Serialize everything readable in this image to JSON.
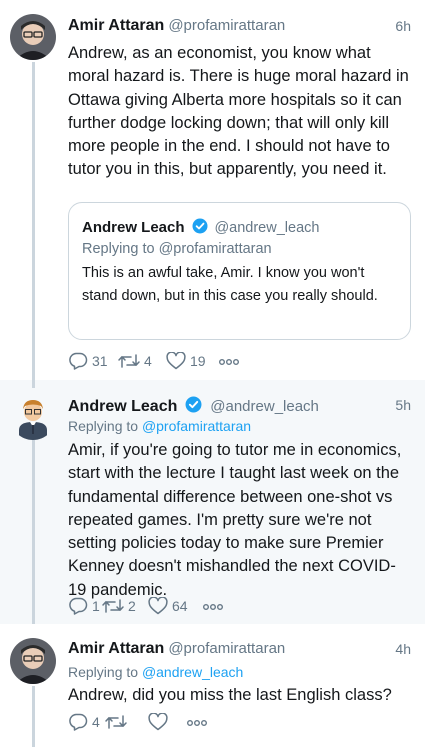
{
  "tweets": [
    {
      "name": "Amir Attaran",
      "handle": "@profamirattaran",
      "time": "6h",
      "text": "Andrew, as an economist, you know what moral hazard is.  There is huge moral hazard in Ottawa giving Alberta more hospitals so it can further dodge locking down; that will only kill more people in the end.  I should not have to tutor you in this, but apparently, you need it.",
      "quote": {
        "name": "Andrew Leach",
        "handle": "@andrew_leach",
        "replying_label": "Replying to",
        "replying_handle": "@profamirattaran",
        "text": "This is  an awful take, Amir. I know you won't stand down, but in this case you really should."
      },
      "stats": {
        "replies": "31",
        "retweets": "4",
        "likes": "19"
      }
    },
    {
      "name": "Andrew Leach",
      "handle": "@andrew_leach",
      "time": "5h",
      "replying_label": "Replying to",
      "replying_handle": "@profamirattaran",
      "text": "Amir, if you're going to tutor me in economics, start with the lecture I taught last week on the fundamental difference between one-shot vs repeated games. I'm pretty sure we're not setting policies today to make sure Premier Kenney doesn't mishandled the next COVID-19 pandemic.",
      "stats": {
        "replies": "1",
        "retweets": "2",
        "likes": "64"
      }
    },
    {
      "name": "Amir Attaran",
      "handle": "@profamirattaran",
      "time": "4h",
      "replying_label": "Replying to",
      "replying_handle": "@andrew_leach",
      "text": "Andrew, did you miss the last English class?",
      "stats": {
        "replies": "4",
        "retweets": "",
        "likes": ""
      }
    }
  ],
  "colors": {
    "link": "#1da1f2",
    "muted": "#657786",
    "verified": "#1da1f2",
    "thread_line": "#cbd5dd"
  },
  "icons": [
    "reply-icon",
    "retweet-icon",
    "like-icon",
    "more-icon",
    "verified-badge-icon"
  ]
}
